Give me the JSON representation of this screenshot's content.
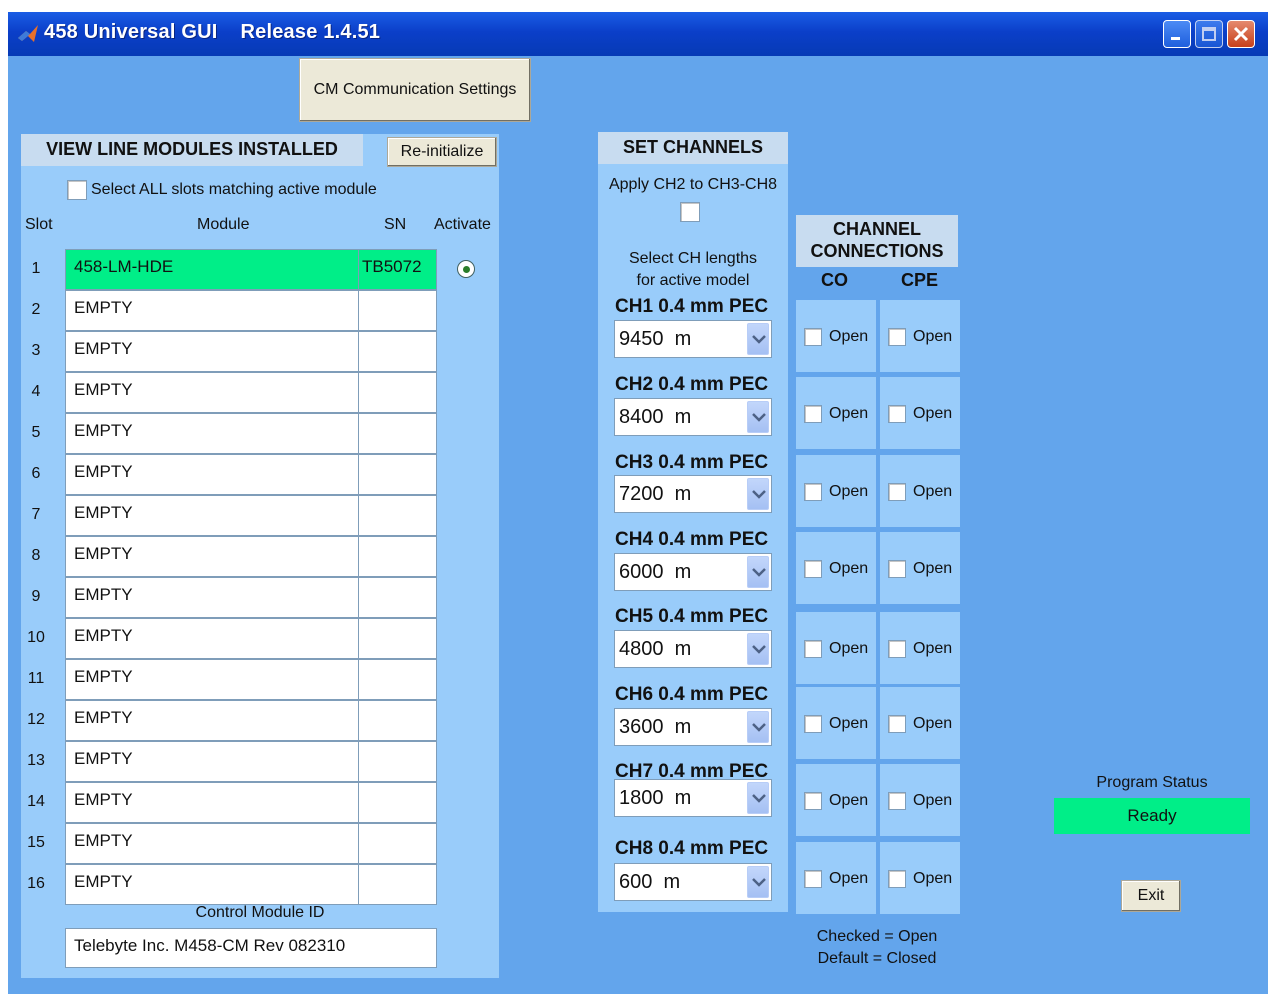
{
  "window": {
    "title": "458 Universal GUI    Release 1.4.51",
    "controls": [
      "minimize-icon",
      "maximize-icon",
      "close-icon"
    ],
    "colors": {
      "background": "#63a5ec",
      "panel": "#99ccfa",
      "selected": "#00ee88",
      "titlebar": "#0b3fc9"
    }
  },
  "cm_settings_button": "CM Communication Settings",
  "modules": {
    "header": "VIEW LINE MODULES INSTALLED",
    "reinit_button": "Re-initialize",
    "select_all_label": "Select ALL slots matching active module",
    "col_slot": "Slot",
    "col_module": "Module",
    "col_sn": "SN",
    "col_activate": "Activate",
    "rows": [
      {
        "slot": "1",
        "module": "458-LM-HDE",
        "sn": "TB5072",
        "active": true
      },
      {
        "slot": "2",
        "module": "EMPTY",
        "sn": ""
      },
      {
        "slot": "3",
        "module": "EMPTY",
        "sn": ""
      },
      {
        "slot": "4",
        "module": "EMPTY",
        "sn": ""
      },
      {
        "slot": "5",
        "module": "EMPTY",
        "sn": ""
      },
      {
        "slot": "6",
        "module": "EMPTY",
        "sn": ""
      },
      {
        "slot": "7",
        "module": "EMPTY",
        "sn": ""
      },
      {
        "slot": "8",
        "module": "EMPTY",
        "sn": ""
      },
      {
        "slot": "9",
        "module": "EMPTY",
        "sn": ""
      },
      {
        "slot": "10",
        "module": "EMPTY",
        "sn": ""
      },
      {
        "slot": "11",
        "module": "EMPTY",
        "sn": ""
      },
      {
        "slot": "12",
        "module": "EMPTY",
        "sn": ""
      },
      {
        "slot": "13",
        "module": "EMPTY",
        "sn": ""
      },
      {
        "slot": "14",
        "module": "EMPTY",
        "sn": ""
      },
      {
        "slot": "15",
        "module": "EMPTY",
        "sn": ""
      },
      {
        "slot": "16",
        "module": "EMPTY",
        "sn": ""
      }
    ],
    "control_module_label": "Control Module ID",
    "control_module_value": "Telebyte Inc. M458-CM Rev 082310"
  },
  "channels": {
    "header": "SET CHANNELS",
    "apply_label": "Apply CH2 to CH3-CH8",
    "select_lengths_line1": "Select CH lengths",
    "select_lengths_line2": "for active model",
    "items": [
      {
        "label": "CH1  0.4 mm PEC",
        "value": "9450  m"
      },
      {
        "label": "CH2  0.4 mm PEC",
        "value": "8400  m"
      },
      {
        "label": "CH3  0.4 mm PEC",
        "value": "7200  m"
      },
      {
        "label": "CH4  0.4 mm PEC",
        "value": "6000  m"
      },
      {
        "label": "CH5  0.4 mm PEC",
        "value": "4800  m"
      },
      {
        "label": "CH6  0.4 mm PEC",
        "value": "3600  m"
      },
      {
        "label": "CH7  0.4 mm PEC",
        "value": "1800  m"
      },
      {
        "label": "CH8  0.4 mm PEC",
        "value": "600  m"
      }
    ]
  },
  "connections": {
    "header_line1": "CHANNEL",
    "header_line2": "CONNECTIONS",
    "col_co": "CO",
    "col_cpe": "CPE",
    "open_label": "Open",
    "note_line1": "Checked = Open",
    "note_line2": "Default = Closed"
  },
  "status": {
    "label": "Program Status",
    "value": "Ready",
    "exit_button": "Exit"
  }
}
